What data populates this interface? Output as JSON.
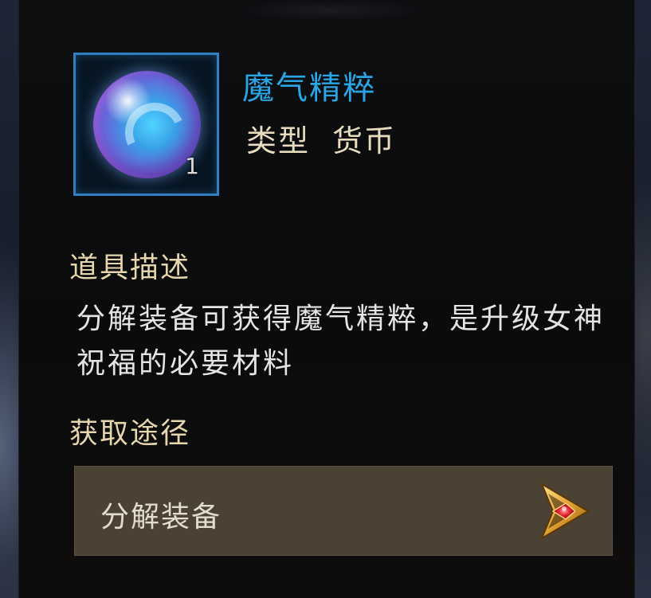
{
  "item": {
    "name": "魔气精粹",
    "type_label": "类型",
    "type_value": "货币",
    "quantity": "1",
    "name_color": "#2aa6e6",
    "icon": "mana-orb-icon"
  },
  "description": {
    "title": "道具描述",
    "text": "分解装备可获得魔气精粹，是升级女神祝福的必要材料"
  },
  "sources": {
    "title": "获取途径",
    "items": [
      {
        "label": "分解装备",
        "icon": "go-arrow-icon"
      }
    ]
  }
}
